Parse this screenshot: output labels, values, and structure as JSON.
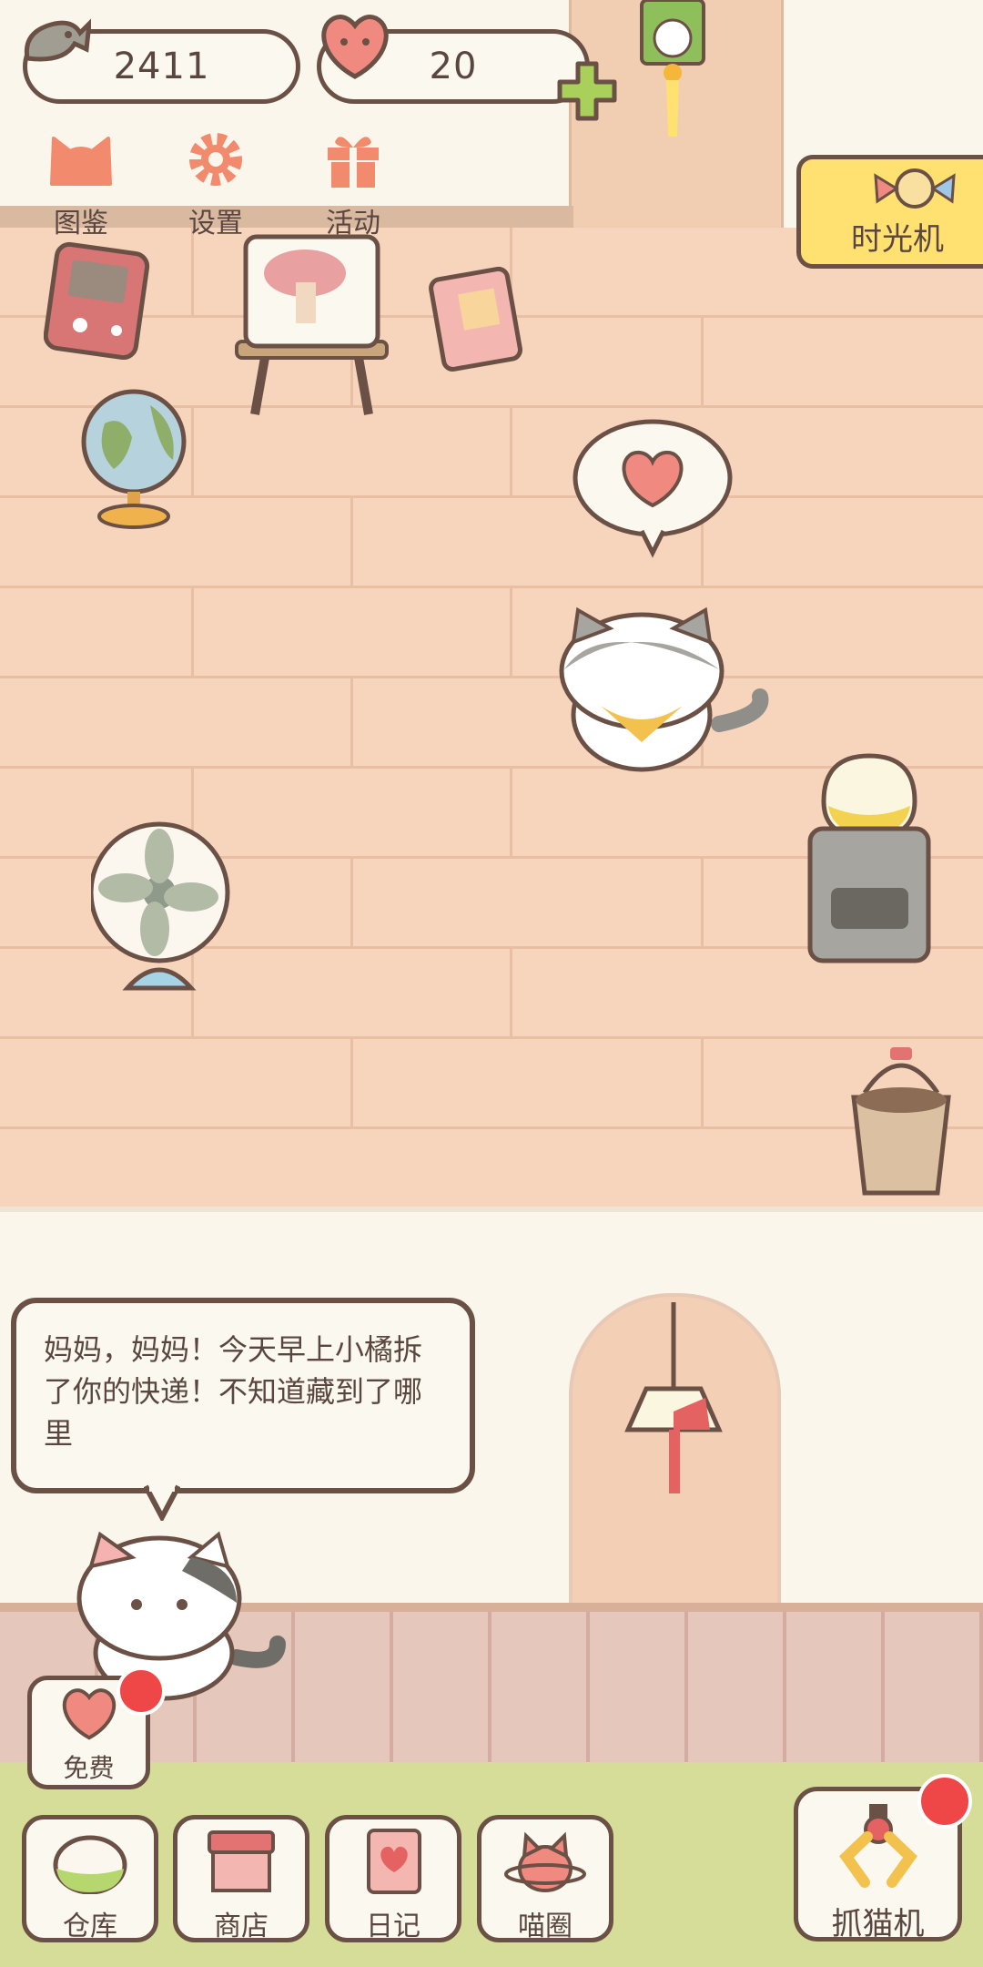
{
  "currency": {
    "fish_count": "2411",
    "heart_count": "20",
    "fish_icon": "fish-icon",
    "heart_icon": "heart-icon",
    "add_icon": "plus-icon"
  },
  "top_menu": [
    {
      "label": "图鉴",
      "icon": "cat-head-icon"
    },
    {
      "label": "设置",
      "icon": "gear-icon"
    },
    {
      "label": "活动",
      "icon": "gift-icon"
    }
  ],
  "time_machine": {
    "label": "时光机",
    "icon": "candy-icon"
  },
  "speech": {
    "text": "妈妈，妈妈！今天早上小橘拆了你的快递！不知道藏到了哪里"
  },
  "free": {
    "label": "免费",
    "icon": "heart-icon"
  },
  "bottom_nav": [
    {
      "label": "仓库",
      "icon": "storage-icon"
    },
    {
      "label": "商店",
      "icon": "shop-icon"
    },
    {
      "label": "日记",
      "icon": "diary-icon"
    },
    {
      "label": "喵圈",
      "icon": "cat-planet-icon"
    }
  ],
  "claw_machine": {
    "label": "抓猫机",
    "icon": "claw-icon"
  },
  "colors": {
    "outline": "#6b5045",
    "heart": "#f08a80",
    "accent_yellow": "#ffe172",
    "badge_red": "#ef4747",
    "floor": "#f6d5bc"
  }
}
